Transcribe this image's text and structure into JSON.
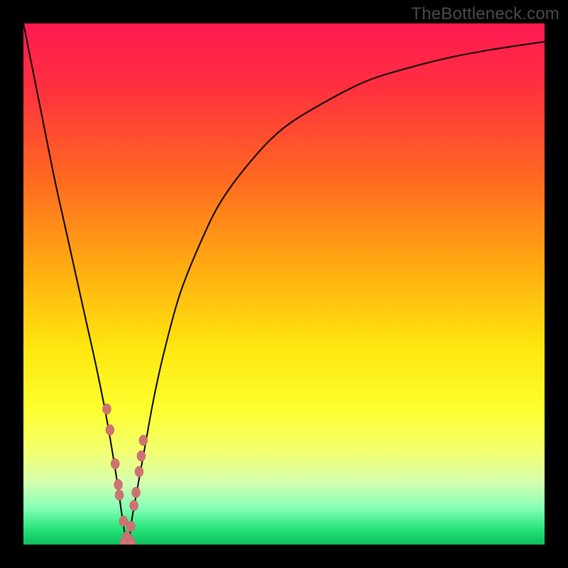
{
  "watermark": "TheBottleneck.com",
  "colors": {
    "frame": "#000000",
    "gradient_stops": [
      {
        "offset": 0.0,
        "color": "#ff1a52"
      },
      {
        "offset": 0.12,
        "color": "#ff2f3f"
      },
      {
        "offset": 0.3,
        "color": "#ff6a20"
      },
      {
        "offset": 0.48,
        "color": "#ffb010"
      },
      {
        "offset": 0.62,
        "color": "#ffe60f"
      },
      {
        "offset": 0.74,
        "color": "#fdff2e"
      },
      {
        "offset": 0.82,
        "color": "#f3ff6e"
      },
      {
        "offset": 0.88,
        "color": "#d6ffb0"
      },
      {
        "offset": 0.93,
        "color": "#86ffb8"
      },
      {
        "offset": 0.97,
        "color": "#25e47a"
      },
      {
        "offset": 1.0,
        "color": "#0fbf5e"
      }
    ],
    "curve": "#000000",
    "marker_fill": "#cf7272",
    "marker_stroke": "#b85d5d"
  },
  "chart_data": {
    "type": "line",
    "x_range": [
      0,
      100
    ],
    "y_range": [
      0,
      100
    ],
    "notch_x": 20,
    "series": [
      {
        "name": "bottleneck-curve",
        "x": [
          0,
          2,
          4,
          6,
          8,
          10,
          12,
          14,
          16,
          18,
          19,
          20,
          21,
          23,
          25,
          27,
          30,
          34,
          38,
          44,
          50,
          58,
          66,
          74,
          82,
          90,
          100
        ],
        "y": [
          100,
          90,
          80,
          70,
          61,
          52,
          43,
          34,
          24,
          12,
          5,
          0,
          6,
          17,
          28,
          37,
          48,
          58,
          66,
          74,
          80,
          85,
          89,
          91.5,
          93.5,
          95,
          96.5
        ]
      }
    ],
    "markers_left": [
      {
        "x": 16.0,
        "y": 26.0
      },
      {
        "x": 16.6,
        "y": 22.0
      },
      {
        "x": 17.6,
        "y": 15.5
      },
      {
        "x": 18.2,
        "y": 11.5
      },
      {
        "x": 18.4,
        "y": 9.5
      },
      {
        "x": 19.2,
        "y": 4.5
      },
      {
        "x": 19.8,
        "y": 1.5
      }
    ],
    "markers_right": [
      {
        "x": 23.0,
        "y": 20.0
      },
      {
        "x": 22.6,
        "y": 17.0
      },
      {
        "x": 22.2,
        "y": 14.0
      },
      {
        "x": 21.6,
        "y": 10.0
      },
      {
        "x": 21.2,
        "y": 7.5
      },
      {
        "x": 20.6,
        "y": 3.5
      },
      {
        "x": 20.2,
        "y": 1.0
      }
    ],
    "markers_bottom": [
      {
        "x": 19.3,
        "y": 0.3
      },
      {
        "x": 20.7,
        "y": 0.3
      }
    ]
  }
}
